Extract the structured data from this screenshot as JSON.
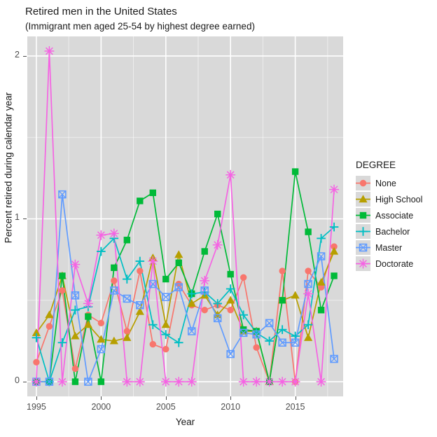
{
  "title": "Retired men in the United States",
  "subtitle": "(Immigrant men aged 25-54 by highest degree earned)",
  "legend": {
    "title": "DEGREE",
    "items": [
      {
        "label": "None",
        "color": "#f8766d",
        "shape": "circle"
      },
      {
        "label": "High School",
        "color": "#b79f00",
        "shape": "triangle"
      },
      {
        "label": "Associate",
        "color": "#00ba38",
        "shape": "square"
      },
      {
        "label": "Bachelor",
        "color": "#00bfc4",
        "shape": "plus"
      },
      {
        "label": "Master",
        "color": "#619cff",
        "shape": "square-x"
      },
      {
        "label": "Doctorate",
        "color": "#f564e3",
        "shape": "asterisk"
      }
    ]
  },
  "axes": {
    "x_label": "Year",
    "y_label": "Percent retired during calendar year",
    "x_ticks": [
      "1995",
      "2000",
      "2005",
      "2010",
      "2015"
    ],
    "y_ticks": [
      "0",
      "1",
      "2"
    ]
  },
  "chart_data": {
    "type": "line",
    "title": "Retired men in the United States",
    "subtitle": "(Immigrant men aged 25-54 by highest degree earned)",
    "xlabel": "Year",
    "ylabel": "Percent retired during calendar year",
    "legend_title": "DEGREE",
    "legend_position": "right",
    "grid": true,
    "xlim": [
      1994.3,
      2018.7
    ],
    "ylim": [
      -0.09,
      2.12
    ],
    "x_ticks": [
      1995,
      2000,
      2005,
      2010,
      2015
    ],
    "y_ticks": [
      0,
      1,
      2
    ],
    "x": [
      1995,
      1996,
      1997,
      1998,
      1999,
      2000,
      2001,
      2002,
      2003,
      2004,
      2005,
      2006,
      2007,
      2008,
      2009,
      2010,
      2011,
      2012,
      2013,
      2014,
      2015,
      2016,
      2017,
      2018
    ],
    "series": [
      {
        "name": "None",
        "color": "#f8766d",
        "shape": "circle",
        "values": [
          0.12,
          0.34,
          0.56,
          0.08,
          0.41,
          0.36,
          0.62,
          0.31,
          0.68,
          0.23,
          0.2,
          0.6,
          0.47,
          0.44,
          0.47,
          0.44,
          0.64,
          0.21,
          0.0,
          0.68,
          0.0,
          0.68,
          0.58,
          0.83
        ]
      },
      {
        "name": "High School",
        "color": "#b79f00",
        "shape": "triangle",
        "values": [
          0.3,
          0.41,
          0.65,
          0.28,
          0.35,
          0.26,
          0.25,
          0.27,
          0.43,
          0.76,
          0.35,
          0.78,
          0.48,
          0.53,
          0.41,
          0.5,
          0.31,
          0.31,
          0.0,
          0.5,
          0.53,
          0.27,
          0.61,
          0.8
        ]
      },
      {
        "name": "Associate",
        "color": "#00ba38",
        "shape": "square",
        "values": [
          0.0,
          0.0,
          0.65,
          0.0,
          0.4,
          0.0,
          0.7,
          0.87,
          1.11,
          1.16,
          0.63,
          0.73,
          0.54,
          0.8,
          1.03,
          0.66,
          0.32,
          0.31,
          0.0,
          0.5,
          1.29,
          0.92,
          0.44,
          0.65
        ]
      },
      {
        "name": "Bachelor",
        "color": "#00bfc4",
        "shape": "plus",
        "values": [
          0.27,
          0.0,
          0.24,
          0.44,
          0.46,
          0.8,
          0.88,
          0.63,
          0.74,
          0.35,
          0.29,
          0.24,
          0.54,
          0.55,
          0.48,
          0.57,
          0.41,
          0.3,
          0.25,
          0.32,
          0.28,
          0.35,
          0.88,
          0.95
        ]
      },
      {
        "name": "Master",
        "color": "#619cff",
        "shape": "square-x",
        "values": [
          0.0,
          0.0,
          1.15,
          0.53,
          0.0,
          0.2,
          0.56,
          0.51,
          0.47,
          0.6,
          0.52,
          0.58,
          0.31,
          0.56,
          0.39,
          0.17,
          0.3,
          0.29,
          0.36,
          0.24,
          0.24,
          0.6,
          0.77,
          0.14
        ]
      },
      {
        "name": "Doctorate",
        "color": "#f564e3",
        "shape": "asterisk",
        "values": [
          0.0,
          2.03,
          0.0,
          0.72,
          0.48,
          0.9,
          0.91,
          0.0,
          0.0,
          0.74,
          0.0,
          0.0,
          0.0,
          0.62,
          0.84,
          1.27,
          0.0,
          0.0,
          0.0,
          0.0,
          0.0,
          0.54,
          0.0,
          1.18
        ]
      }
    ]
  }
}
